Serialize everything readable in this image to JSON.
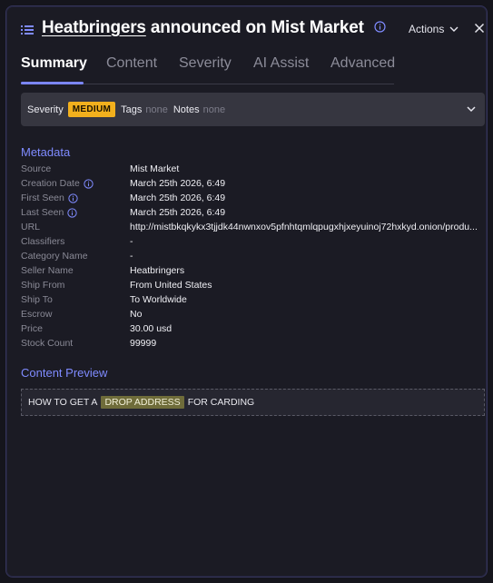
{
  "header": {
    "seller": "Heatbringers",
    "title_rest": "announced on Mist Market",
    "actions_label": "Actions"
  },
  "tabs": [
    {
      "label": "Summary",
      "active": true
    },
    {
      "label": "Content",
      "active": false
    },
    {
      "label": "Severity",
      "active": false
    },
    {
      "label": "AI Assist",
      "active": false
    },
    {
      "label": "Advanced",
      "active": false
    }
  ],
  "severity_bar": {
    "severity_label": "Severity",
    "severity_value": "MEDIUM",
    "tags_label": "Tags",
    "tags_value": "none",
    "notes_label": "Notes",
    "notes_value": "none"
  },
  "metadata": {
    "title": "Metadata",
    "rows": [
      {
        "label": "Source",
        "value": "Mist Market",
        "info": false
      },
      {
        "label": "Creation Date",
        "value": "March 25th 2026, 6:49",
        "info": true
      },
      {
        "label": "First Seen",
        "value": "March 25th 2026, 6:49",
        "info": true
      },
      {
        "label": "Last Seen",
        "value": "March 25th 2026, 6:49",
        "info": true
      },
      {
        "label": "URL",
        "value": "http://mistbkqkykx3tjjdk44nwnxov5pfnhtqmlqpugxhjxeyuinoj72hxkyd.onion/produ...",
        "info": false
      },
      {
        "label": "Classifiers",
        "value": "-",
        "info": false
      },
      {
        "label": "Category Name",
        "value": "-",
        "info": false
      },
      {
        "label": "Seller Name",
        "value": "Heatbringers",
        "info": false
      },
      {
        "label": "Ship From",
        "value": "From United States",
        "info": false
      },
      {
        "label": "Ship To",
        "value": "To Worldwide",
        "info": false
      },
      {
        "label": "Escrow",
        "value": "No",
        "info": false
      },
      {
        "label": "Price",
        "value": "30.00 usd",
        "info": false
      },
      {
        "label": "Stock Count",
        "value": "99999",
        "info": false
      }
    ]
  },
  "content_preview": {
    "title": "Content Preview",
    "before": "HOW TO GET A",
    "highlight": "DROP ADDRESS",
    "after": "FOR CARDING"
  },
  "colors": {
    "accent": "#7b86ff",
    "severity_medium": "#f2b01d",
    "highlight": "#6f6c3a"
  },
  "icons": [
    "list-menu-icon",
    "info-icon",
    "chevron-down-icon",
    "close-icon"
  ]
}
